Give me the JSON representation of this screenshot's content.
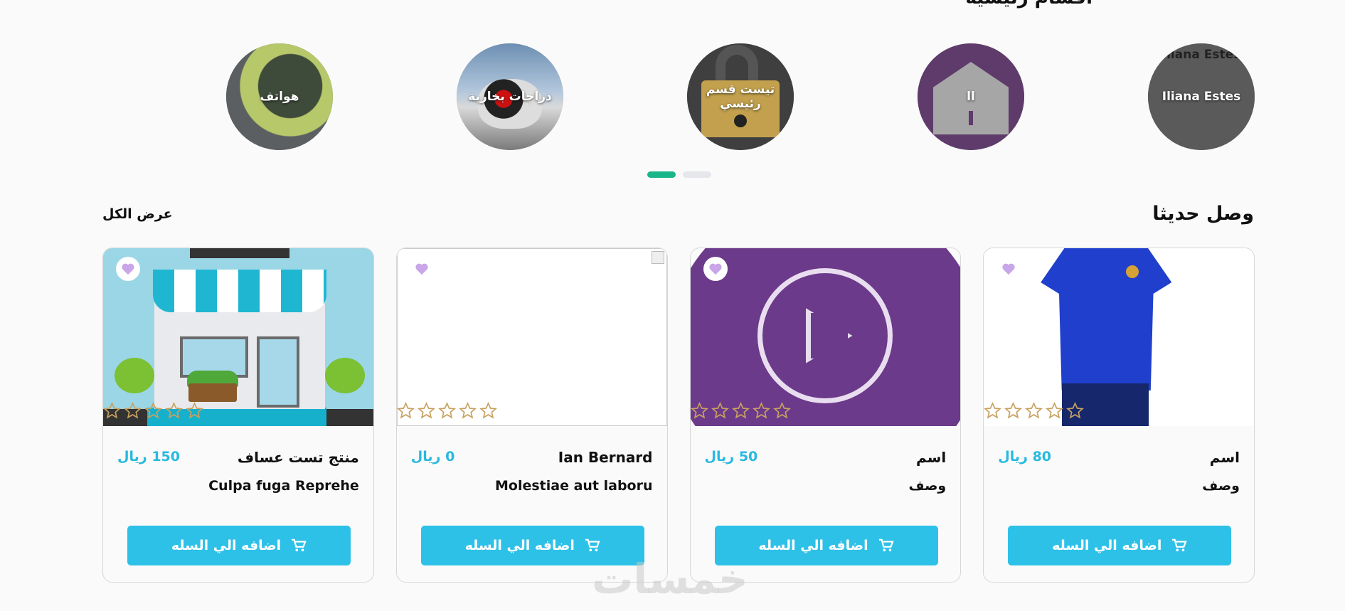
{
  "categories_section": {
    "title": "أقسام رئيسية",
    "items": [
      {
        "label": "هواتف"
      },
      {
        "label": "دراجات بخارية"
      },
      {
        "label": "تيست قسم رئيسي"
      },
      {
        "label": "ll"
      },
      {
        "label": "Iliana Estes",
        "overlay_label": "Iliana Estes"
      }
    ]
  },
  "carousel": {
    "active_index": 1,
    "count": 2
  },
  "new_arrivals": {
    "title": "وصل حديثا",
    "view_all": "عرض الكل",
    "products": [
      {
        "name": "منتج تست عساف",
        "price": "150 ريال",
        "description": "Culpa fuga Reprehe",
        "add_to_cart": "اضافه الي السله",
        "rating": 0,
        "image": "store-image"
      },
      {
        "name": "Ian Bernard",
        "price": "0 ريال",
        "description": "Molestiae aut laboru",
        "add_to_cart": "اضافه الي السله",
        "rating": 0,
        "image": "broken-image"
      },
      {
        "name": "اسم",
        "price": "50 ريال",
        "description": "وصف",
        "add_to_cart": "اضافه الي السله",
        "rating": 0,
        "image": "play-image"
      },
      {
        "name": "اسم",
        "price": "80 ريال",
        "description": "وصف",
        "add_to_cart": "اضافه الي السله",
        "rating": 0,
        "image": "shirt-image"
      }
    ]
  },
  "watermark": "خمسات",
  "colors": {
    "accent": "#2ec1e8",
    "price": "#27b9e0",
    "active_dot": "#1bb58a",
    "heart": "#c9a6e8",
    "star": "#c8a15f"
  }
}
